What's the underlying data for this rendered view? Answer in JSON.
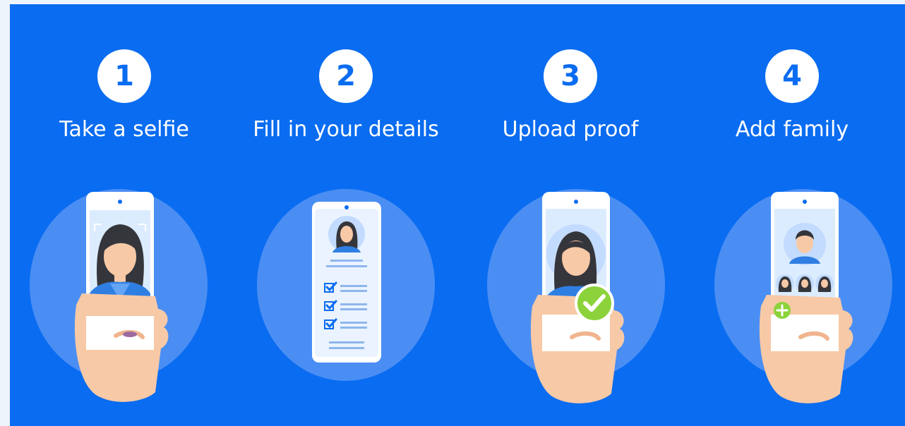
{
  "colors": {
    "panel": "#0a6cf0",
    "halo": "#4a8ef4",
    "white": "#ffffff",
    "skin": "#f8c9a6",
    "hair": "#35363b",
    "shirt": "#2f7fe3",
    "screen": "#ddeeff",
    "accent_green": "#8cd33b"
  },
  "steps": [
    {
      "number": "1",
      "title": "Take a selfie",
      "icon": "selfie-phone-icon"
    },
    {
      "number": "2",
      "title": "Fill in your details",
      "icon": "details-form-phone-icon"
    },
    {
      "number": "3",
      "title": "Upload proof",
      "icon": "upload-proof-phone-icon"
    },
    {
      "number": "4",
      "title": "Add family",
      "icon": "add-family-phone-icon"
    }
  ]
}
